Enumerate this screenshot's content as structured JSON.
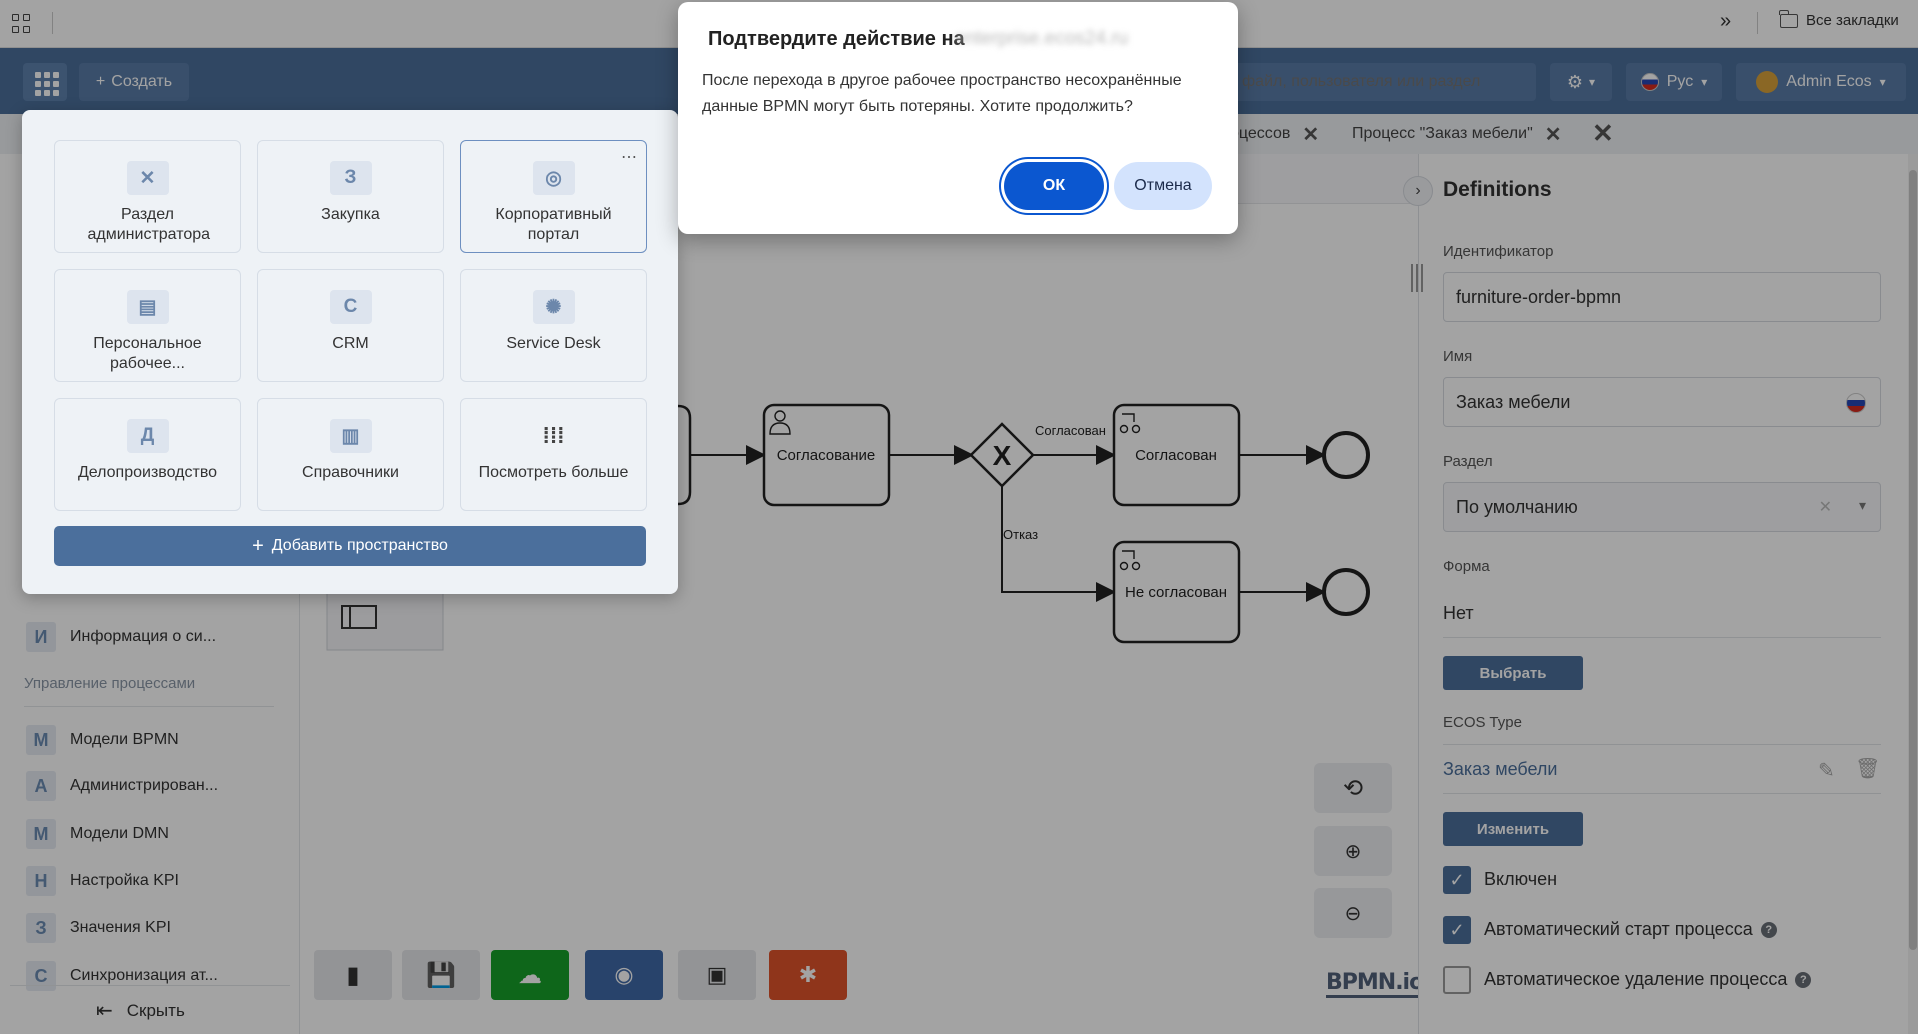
{
  "browser": {
    "bookmarks_label": "Все закладки",
    "more_label": "»"
  },
  "header": {
    "create_label": "Создать",
    "search_placeholder": "файл, пользователя или раздел",
    "lang_label": "Рус",
    "user_label": "Admin Ecos"
  },
  "tabs": [
    {
      "label": "оцессов"
    },
    {
      "label": "Процесс \"Заказ мебели\""
    }
  ],
  "sidebar": {
    "top_items": [
      {
        "letter": "И",
        "label": "Информация о си..."
      }
    ],
    "section_title": "Управление процессами",
    "items": [
      {
        "letter": "М",
        "label": "Модели BPMN"
      },
      {
        "letter": "А",
        "label": "Администрирован..."
      },
      {
        "letter": "М",
        "label": "Модели DMN"
      },
      {
        "letter": "Н",
        "label": "Настройка KPI"
      },
      {
        "letter": "З",
        "label": "Значения KPI"
      },
      {
        "letter": "С",
        "label": "Синхронизация ат..."
      }
    ],
    "hide_label": "Скрыть"
  },
  "workspaces": {
    "tiles": [
      {
        "icon": "wrench-icon",
        "glyph": "",
        "label": "Раздел администратора"
      },
      {
        "icon": "letter-icon",
        "glyph": "З",
        "label": "Закупка"
      },
      {
        "icon": "globe-icon",
        "glyph": "",
        "label": "Корпоративный портал"
      },
      {
        "icon": "store-icon",
        "glyph": "",
        "label": "Персональное рабочее..."
      },
      {
        "icon": "letter-icon",
        "glyph": "C",
        "label": "CRM"
      },
      {
        "icon": "lifebuoy-icon",
        "glyph": "",
        "label": "Service Desk"
      },
      {
        "icon": "letter-icon",
        "glyph": "Д",
        "label": "Делопроизводство"
      },
      {
        "icon": "book-icon",
        "glyph": "",
        "label": "Справочники"
      },
      {
        "icon": "grid-icon",
        "glyph": "",
        "label": "Посмотреть больше"
      }
    ],
    "add_label": "Добавить пространство"
  },
  "diagram": {
    "task_approval": "Согласование",
    "task_approved": "Согласован",
    "task_rejected": "Не согласован",
    "flow_approved": "Согласован",
    "flow_rejected": "Отказ",
    "logo": "BPMN.io"
  },
  "props": {
    "title": "Definitions",
    "id_label": "Идентификатор",
    "id_value": "furniture-order-bpmn",
    "name_label": "Имя",
    "name_value": "Заказ мебели",
    "section_label": "Раздел",
    "section_value": "По умолчанию",
    "form_label": "Форма",
    "form_value": "Нет",
    "choose_label": "Выбрать",
    "ecos_type_label": "ECOS Type",
    "ecos_type_value": "Заказ мебели",
    "change_label": "Изменить",
    "enabled_label": "Включен",
    "autostart_label": "Автоматический старт процесса",
    "autodelete_label": "Автоматическое удаление процесса"
  },
  "dialog": {
    "title": "Подтвердите действие на",
    "host": "enterprise.ecos24.ru",
    "message": "После перехода в другое рабочее пространство несохранённые данные BPMN могут быть потеряны. Хотите продолжить?",
    "ok_label": "ОК",
    "cancel_label": "Отмена"
  },
  "colors": {
    "header": "#4b6f9c",
    "ok_button": "#0b57d0",
    "deploy_button": "#17a02a",
    "debug_button": "#e0532b"
  }
}
